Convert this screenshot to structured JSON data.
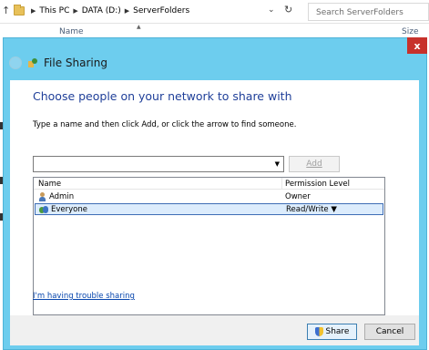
{
  "explorer": {
    "breadcrumbs": [
      "This PC",
      "DATA (D:)",
      "ServerFolders"
    ],
    "search_placeholder": "Search ServerFolders",
    "column_name": "Name",
    "column_size": "Size"
  },
  "dialog": {
    "title": "File Sharing",
    "close_label": "x",
    "heading": "Choose people on your network to share with",
    "instruction": "Type a name and then click Add, or click the arrow to find someone.",
    "name_input_value": "",
    "add_button_label": "Add",
    "list": {
      "columns": [
        "Name",
        "Permission Level"
      ],
      "rows": [
        {
          "name": "Admin",
          "permission": "Owner",
          "icon": "user-icon",
          "selected": false
        },
        {
          "name": "Everyone",
          "permission": "Read/Write ▼",
          "icon": "group-icon",
          "selected": true
        }
      ]
    },
    "trouble_link": "I'm having trouble sharing",
    "share_button_label": "Share",
    "cancel_button_label": "Cancel"
  },
  "colors": {
    "frame_blue": "#6dcdee",
    "heading_blue": "#1f3f99",
    "close_red": "#c7312b",
    "selection_bg": "#dcecfc"
  }
}
